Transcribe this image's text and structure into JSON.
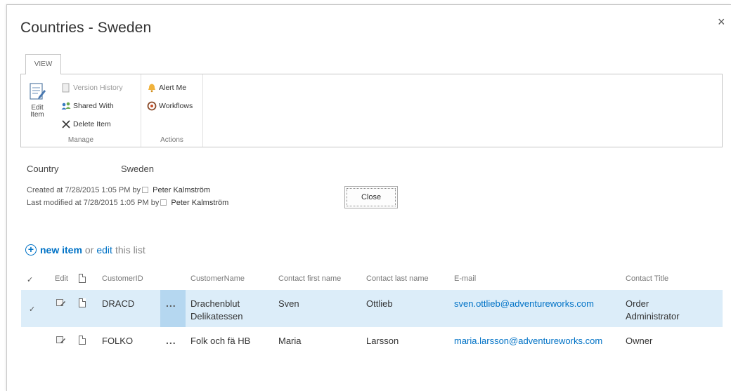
{
  "dialog": {
    "title": "Countries - Sweden",
    "close_glyph": "×"
  },
  "ribbon": {
    "tab_label": "VIEW",
    "manage": {
      "label": "Manage",
      "edit_item": "Edit Item",
      "version_history": "Version History",
      "shared_with": "Shared With",
      "delete_item": "Delete Item"
    },
    "actions": {
      "label": "Actions",
      "alert_me": "Alert Me",
      "workflows": "Workflows"
    }
  },
  "form": {
    "field_label": "Country",
    "field_value": "Sweden",
    "created": "Created at 7/28/2015 1:05 PM  by",
    "created_by": "Peter Kalmström",
    "modified": "Last modified at 7/28/2015 1:05 PM  by",
    "modified_by": "Peter Kalmström",
    "close_label": "Close"
  },
  "list_toolbar": {
    "new_item": "new item",
    "or": "or",
    "edit": "edit",
    "this_list": "this list"
  },
  "table": {
    "check_glyph": "✓",
    "headers": {
      "edit": "Edit",
      "customer_id": "CustomerID",
      "customer_name": "CustomerName",
      "first_name": "Contact first name",
      "last_name": "Contact last name",
      "email": "E-mail",
      "title": "Contact Title"
    },
    "rows": [
      {
        "selected": true,
        "customer_id": "DRACD",
        "customer_name_1": "Drachenblut",
        "customer_name_2": "Delikatessen",
        "first_name": "Sven",
        "last_name": "Ottlieb",
        "email": "sven.ottlieb@adventureworks.com",
        "title_1": "Order",
        "title_2": "Administrator"
      },
      {
        "selected": false,
        "customer_id": "FOLKO",
        "customer_name_1": "Folk och fä HB",
        "first_name": "Maria",
        "last_name": "Larsson",
        "email": "maria.larsson@adventureworks.com",
        "title_1": "Owner"
      }
    ],
    "ellipsis": "..."
  },
  "colors": {
    "link": "#0072c6",
    "selected_row": "#cde6f7"
  }
}
